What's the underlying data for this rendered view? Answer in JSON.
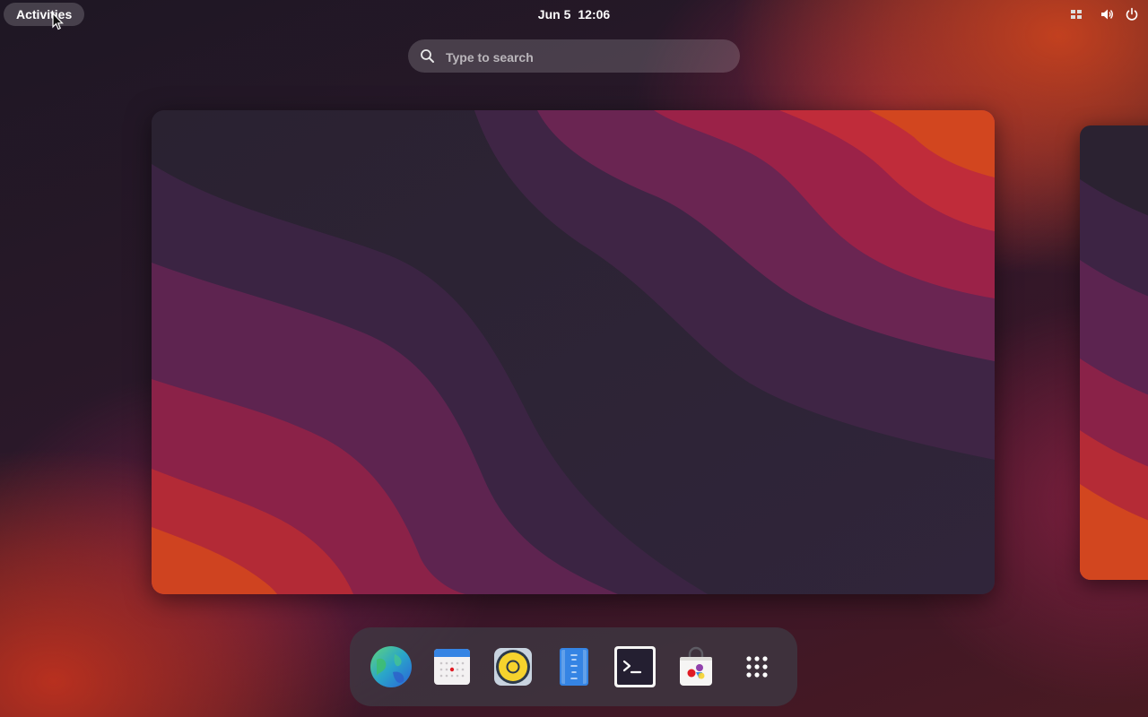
{
  "topbar": {
    "activities_label": "Activities",
    "date": "Jun 5",
    "time": "12:06",
    "tray_icons": [
      "workspace-indicator-icon",
      "volume-icon",
      "power-icon"
    ]
  },
  "search": {
    "placeholder": "Type to search",
    "value": ""
  },
  "dash": {
    "apps": [
      {
        "name": "browser",
        "icon": "globe-icon"
      },
      {
        "name": "calendar",
        "icon": "calendar-icon"
      },
      {
        "name": "music-player",
        "icon": "speaker-icon"
      },
      {
        "name": "text-editor",
        "icon": "text-editor-icon"
      },
      {
        "name": "terminal",
        "icon": "terminal-icon"
      },
      {
        "name": "software-store",
        "icon": "shopping-bag-icon"
      },
      {
        "name": "app-grid",
        "icon": "app-grid-icon"
      }
    ]
  },
  "colors": {
    "wallpaper_dark": "#241d2a",
    "wallpaper_magenta": "#7a2456",
    "wallpaper_red": "#b8223c",
    "wallpaper_orange": "#d2461f",
    "dash_background": "#3e3842"
  }
}
